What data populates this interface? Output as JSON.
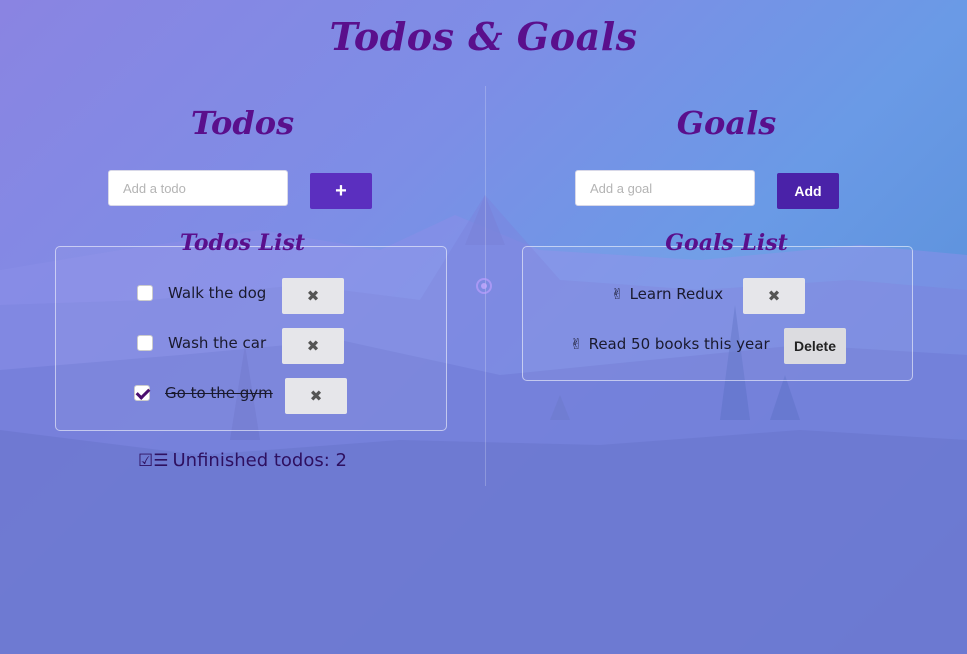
{
  "app": {
    "title": "Todos & Goals"
  },
  "todos": {
    "title": "Todos",
    "input_placeholder": "Add a todo",
    "add_label": "+",
    "list_title": "Todos List",
    "items": [
      {
        "text": "Walk the dog",
        "done": false
      },
      {
        "text": "Wash the car",
        "done": false
      },
      {
        "text": "Go to the gym",
        "done": true
      }
    ],
    "remove_label": "✖",
    "unfinished_label": "Unfinished todos: 2",
    "unfinished_icon": "list-check-icon"
  },
  "goals": {
    "title": "Goals",
    "input_placeholder": "Add a goal",
    "add_label": "Add",
    "list_title": "Goals List",
    "item_icon": "✌",
    "items": [
      {
        "text": "Learn Redux",
        "remove_label": "✖"
      },
      {
        "text": "Read 50 books this year",
        "remove_label": "Delete"
      }
    ]
  },
  "colors": {
    "title": "#5a0f8c",
    "accent_button": "#5b2fbf",
    "remove_button": "#e6e6ea"
  }
}
